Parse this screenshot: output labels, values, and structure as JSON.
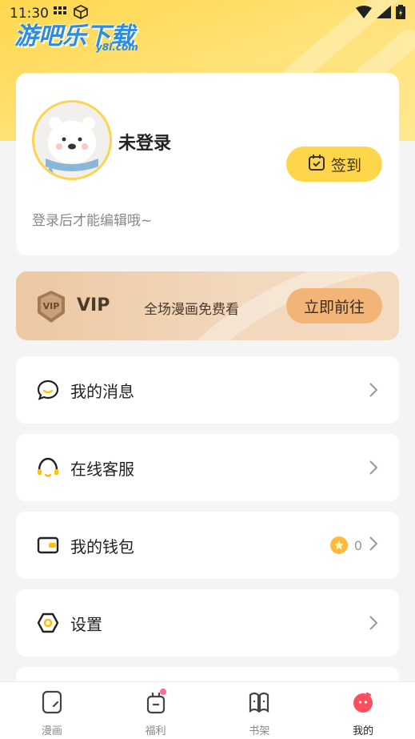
{
  "status_bar": {
    "time": "11:30"
  },
  "watermark": {
    "title": "游吧乐下载",
    "sub": "y8l.com"
  },
  "profile": {
    "username": "未登录",
    "hint": "登录后才能编辑哦~",
    "checkin_label": "签到"
  },
  "vip": {
    "badge": "VIP",
    "label": "VIP",
    "description": "全场漫画免费看",
    "button": "立即前往"
  },
  "menu": {
    "messages": "我的消息",
    "support": "在线客服",
    "wallet": "我的钱包",
    "wallet_balance": "0",
    "settings": "设置"
  },
  "tabbar": {
    "tabs": [
      {
        "label": "漫画",
        "icon": "comic-icon"
      },
      {
        "label": "福利",
        "icon": "gift-icon"
      },
      {
        "label": "书架",
        "icon": "bookshelf-icon"
      },
      {
        "label": "我的",
        "icon": "profile-icon"
      }
    ],
    "active_index": 3
  },
  "colors": {
    "accent_yellow": "#ffd54a",
    "vip_bg": "#ecc8a3",
    "vip_button": "#f3b577",
    "active_tab": "#ff4f5e"
  }
}
